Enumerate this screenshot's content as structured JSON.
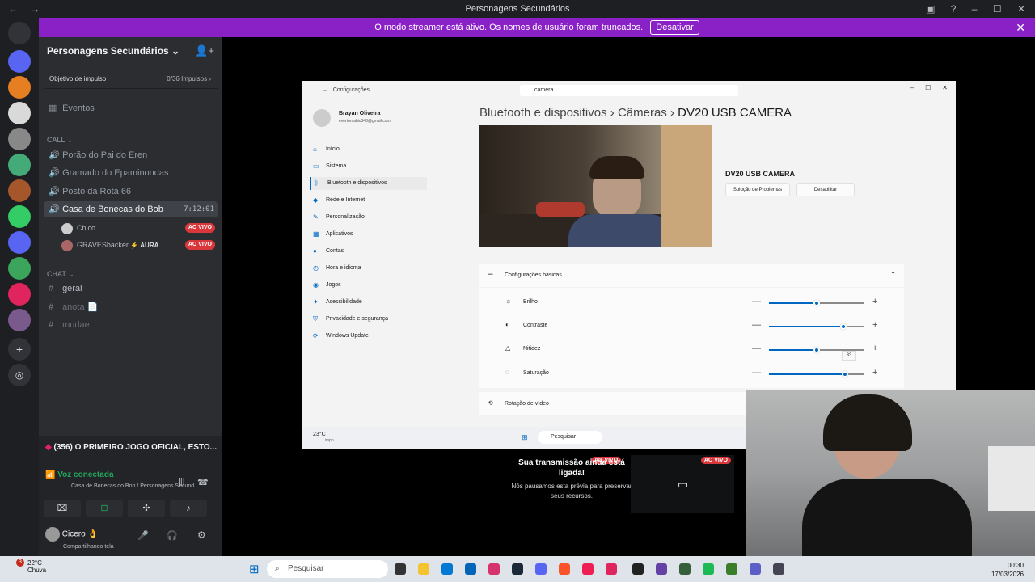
{
  "titlebar": {
    "title": "Personagens Secundários",
    "back": "←",
    "forward": "→"
  },
  "banner": {
    "message": "O modo streamer está ativo. Os nomes de usuário foram truncados.",
    "button": "Desativar"
  },
  "guild": {
    "name": "Personagens Secundários ⌄",
    "boost_label": "Objetivo de impulso",
    "boost_value": "0/36 Impulsos ›",
    "events": "Eventos"
  },
  "categories": {
    "call": "CALL ⌄",
    "chat": "CHAT ⌄"
  },
  "voice_channels": [
    {
      "name": "Porão do Pai do Eren"
    },
    {
      "name": "Gramado do Epaminondas"
    },
    {
      "name": "Posto da Rota 66"
    },
    {
      "name": "Casa de Bonecas do Bob",
      "timer": "7:12:01"
    }
  ],
  "voice_users": [
    {
      "name": "Chico",
      "badge": "AO VIVO"
    },
    {
      "name": "GRAVESbacker",
      "tag": "⚡ AURA",
      "badge": "AO VIVO"
    }
  ],
  "text_channels": [
    {
      "name": "geral"
    },
    {
      "name": "anota 📄"
    },
    {
      "name": "mudae"
    }
  ],
  "panel": {
    "now_playing": "(356) O PRIMEIRO JOGO OFICIAL, ESTO...",
    "voice_status": "Voz conectada",
    "voice_location": "Casa de Bonecas do Bob / Personagens Secund...",
    "user": "Cicero 👌",
    "user_status": "Compartilhando tela"
  },
  "settings": {
    "header": "Configurações",
    "search": "camera",
    "user_name": "Brayan Oliveira",
    "user_email": "evertonfabio348@gmail.com",
    "menu": [
      {
        "label": "Início",
        "icon": "⌂"
      },
      {
        "label": "Sistema",
        "icon": "▭"
      },
      {
        "label": "Bluetooth e dispositivos",
        "icon": "ᛒ"
      },
      {
        "label": "Rede e Internet",
        "icon": "◆"
      },
      {
        "label": "Personalização",
        "icon": "✎"
      },
      {
        "label": "Aplicativos",
        "icon": "▦"
      },
      {
        "label": "Contas",
        "icon": "●"
      },
      {
        "label": "Hora e idioma",
        "icon": "◷"
      },
      {
        "label": "Jogos",
        "icon": "◉"
      },
      {
        "label": "Acessibilidade",
        "icon": "✦"
      },
      {
        "label": "Privacidade e segurança",
        "icon": "⛨"
      },
      {
        "label": "Windows Update",
        "icon": "⟳"
      }
    ],
    "crumb_1": "Bluetooth e dispositivos",
    "crumb_sep": "›",
    "crumb_2": "Câmeras",
    "crumb_3": "DV20 USB CAMERA",
    "camera_name": "DV20 USB CAMERA",
    "btn_troubleshoot": "Solução de Problemas",
    "btn_disable": "Desabilitar",
    "basic_settings": "Configurações básicas",
    "sliders": [
      {
        "label": "Brilho",
        "icon": "☼",
        "value": 0.5
      },
      {
        "label": "Contraste",
        "icon": "◐",
        "value": 0.78
      },
      {
        "label": "Nitidez",
        "icon": "△",
        "value": 0.5
      },
      {
        "label": "Saturação",
        "icon": "◌",
        "value": 0.8
      }
    ],
    "tooltip": "83",
    "rotation": "Rotação de vídeo",
    "weather_temp": "23°C",
    "weather_cond": "Limpo",
    "taskbar_search": "Pesquisar"
  },
  "preview": {
    "badge": "AO VIVO",
    "title": "Sua transmissão ainda está ligada!",
    "subtitle": "Nós pausamos esta prévia para preservar seus recursos."
  },
  "taskbar": {
    "temp": "22°C",
    "weather": "Chuva",
    "search": "Pesquisar",
    "time": "00:30",
    "date": "17/03/2026",
    "notif_count": "3"
  },
  "colors": {
    "banner": "#8a21c7",
    "live": "#da373c",
    "connected": "#23a55a",
    "accent": "#0067c0"
  }
}
